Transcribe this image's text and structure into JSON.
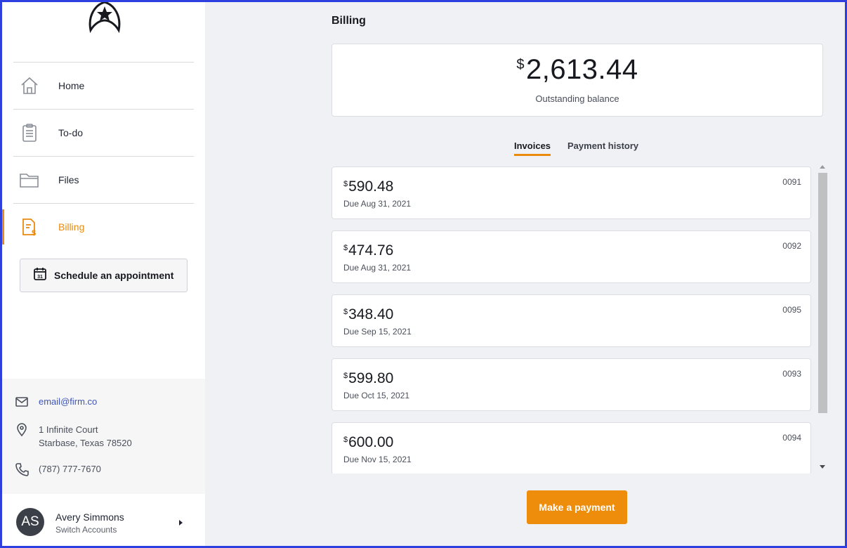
{
  "colors": {
    "accent": "#ea8a0f",
    "link": "#3e55b8",
    "frame": "#2e3fe0"
  },
  "sidebar": {
    "logo": "starfleet-logo",
    "items": [
      {
        "label": "Home",
        "icon": "house-icon"
      },
      {
        "label": "To-do",
        "icon": "clipboard-icon"
      },
      {
        "label": "Files",
        "icon": "folder-icon"
      },
      {
        "label": "Billing",
        "icon": "billing-document-icon",
        "active": true
      }
    ],
    "schedule_button": "Schedule an appointment",
    "schedule_icon_day": "31",
    "contact": {
      "email": "email@firm.co",
      "address_line1": "1 Infinite Court",
      "address_line2": "Starbase, Texas 78520",
      "phone": "(787) 777-7670"
    },
    "user": {
      "initials": "AS",
      "name": "Avery Simmons",
      "sub": "Switch Accounts"
    }
  },
  "main": {
    "title": "Billing",
    "balance": {
      "currency": "$",
      "amount": "2,613.44",
      "label": "Outstanding balance"
    },
    "tabs": [
      {
        "label": "Invoices",
        "active": true
      },
      {
        "label": "Payment history",
        "active": false
      }
    ],
    "invoices": [
      {
        "currency": "$",
        "amount": "590.48",
        "due": "Due Aug 31, 2021",
        "number": "0091"
      },
      {
        "currency": "$",
        "amount": "474.76",
        "due": "Due Aug 31, 2021",
        "number": "0092"
      },
      {
        "currency": "$",
        "amount": "348.40",
        "due": "Due Sep 15, 2021",
        "number": "0095"
      },
      {
        "currency": "$",
        "amount": "599.80",
        "due": "Due Oct 15, 2021",
        "number": "0093"
      },
      {
        "currency": "$",
        "amount": "600.00",
        "due": "Due Nov 15, 2021",
        "number": "0094"
      }
    ],
    "pay_button": "Make a payment"
  }
}
